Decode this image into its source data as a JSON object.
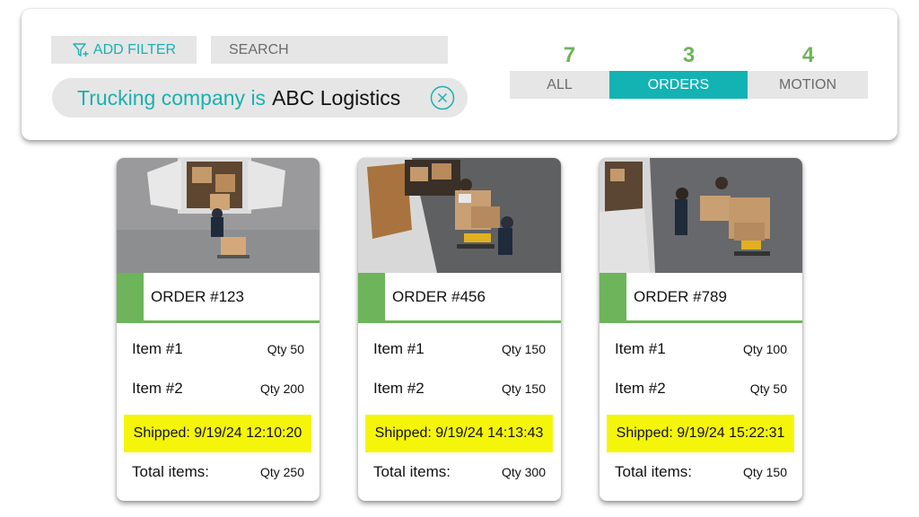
{
  "filter_bar": {
    "add_filter_label": "ADD FILTER",
    "search_placeholder": "SEARCH",
    "chip": {
      "key": "Trucking company is",
      "value": "ABC Logistics",
      "icon": "close-circle-icon"
    }
  },
  "segments": [
    {
      "count": "7",
      "label": "ALL",
      "active": false
    },
    {
      "count": "3",
      "label": "ORDERS",
      "active": true
    },
    {
      "count": "4",
      "label": "MOTION",
      "active": false
    }
  ],
  "colors": {
    "accent_teal": "#13b3b3",
    "count_green": "#6db45a",
    "highlight_yellow": "#f5f50a"
  },
  "orders": [
    {
      "title": "ORDER #123",
      "items": [
        {
          "label": "Item #1",
          "qty": "Qty 50"
        },
        {
          "label": "Item #2",
          "qty": "Qty 200"
        }
      ],
      "shipped": "Shipped: 9/19/24 12:10:20",
      "total_label": "Total items:",
      "total_qty": "Qty 250"
    },
    {
      "title": "ORDER #456",
      "items": [
        {
          "label": "Item #1",
          "qty": "Qty 150"
        },
        {
          "label": "Item #2",
          "qty": "Qty 150"
        }
      ],
      "shipped": "Shipped: 9/19/24 14:13:43",
      "total_label": "Total items:",
      "total_qty": "Qty 300"
    },
    {
      "title": "ORDER #789",
      "items": [
        {
          "label": "Item #1",
          "qty": "Qty 100"
        },
        {
          "label": "Item #2",
          "qty": "Qty 50"
        }
      ],
      "shipped": "Shipped: 9/19/24 15:22:31",
      "total_label": "Total items:",
      "total_qty": "Qty 150"
    }
  ]
}
